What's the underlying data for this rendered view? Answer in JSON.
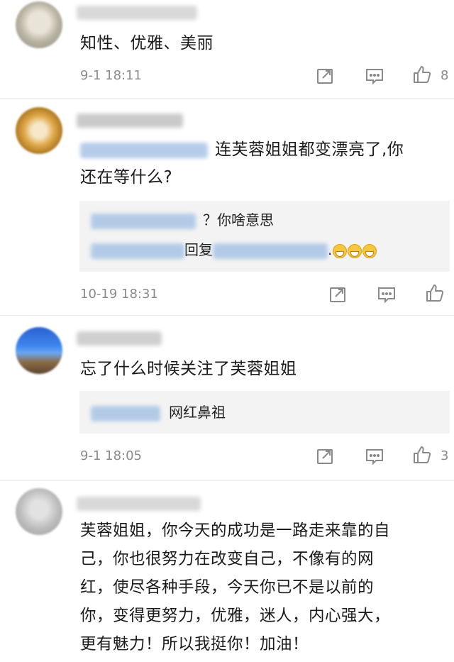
{
  "comments": [
    {
      "text": "知性、优雅、美丽",
      "time": "9-1 18:11",
      "likes": "8"
    },
    {
      "text_part1": "连芙蓉姐姐都变漂亮了,你",
      "text_part2": "还在等什么?",
      "replies": [
        {
          "text": "？你啥意思"
        },
        {
          "text_a": "回复",
          "text_b": "."
        }
      ],
      "time": "10-19 18:31",
      "likes": ""
    },
    {
      "text": "忘了什么时候关注了芙蓉姐姐",
      "replies": [
        {
          "text": "网红鼻祖"
        }
      ],
      "time": "9-1 18:05",
      "likes": "3"
    },
    {
      "lines": [
        "芙蓉姐姐，你今天的成功是一路走来靠的自",
        "己，你也很努力在改变自己，不像有的网",
        "红，使尽各种手段，今天你已不是以前的",
        "你，变得更努力，优雅，迷人，内心强大，",
        "更有魅力！所以我挺你！加油！"
      ]
    }
  ],
  "colors": {
    "meta_text": "#8a8a8a",
    "reply_bg": "#f3f3f3",
    "separator": "#ececec",
    "emoji": "#f7c640"
  },
  "icons": [
    "repost-icon",
    "comment-icon",
    "like-icon",
    "grinning-emoji"
  ]
}
